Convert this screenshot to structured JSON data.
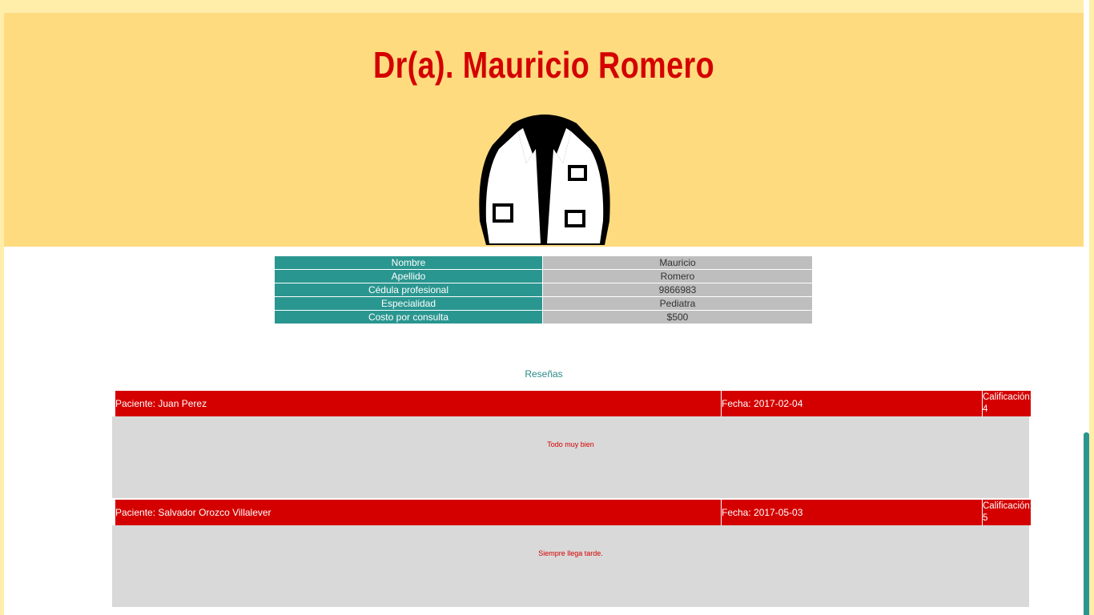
{
  "doctor": {
    "title": "Dr(a). Mauricio Romero",
    "icon": "lab-coat-icon"
  },
  "info": {
    "rows": [
      {
        "label": "Nombre",
        "value": "Mauricio"
      },
      {
        "label": "Apellido",
        "value": "Romero"
      },
      {
        "label": "Cédula profesional",
        "value": "9866983"
      },
      {
        "label": "Especialidad",
        "value": "Pediatra"
      },
      {
        "label": "Costo por consulta",
        "value": "$500"
      }
    ]
  },
  "reviews": {
    "title": "Reseñas",
    "items": [
      {
        "patient": "Paciente: Juan Perez",
        "date": "Fecha: 2017-02-04",
        "rating": "Calificación: 4",
        "comment": "Todo muy bien"
      },
      {
        "patient": "Paciente: Salvador Orozco Villalever",
        "date": "Fecha: 2017-05-03",
        "rating": "Calificación: 5",
        "comment": "Siempre llega tarde."
      }
    ]
  },
  "colors": {
    "header_bg": "#ffdb80",
    "title_red": "#d40000",
    "teal": "#2a9690",
    "gray": "#bebebe"
  }
}
